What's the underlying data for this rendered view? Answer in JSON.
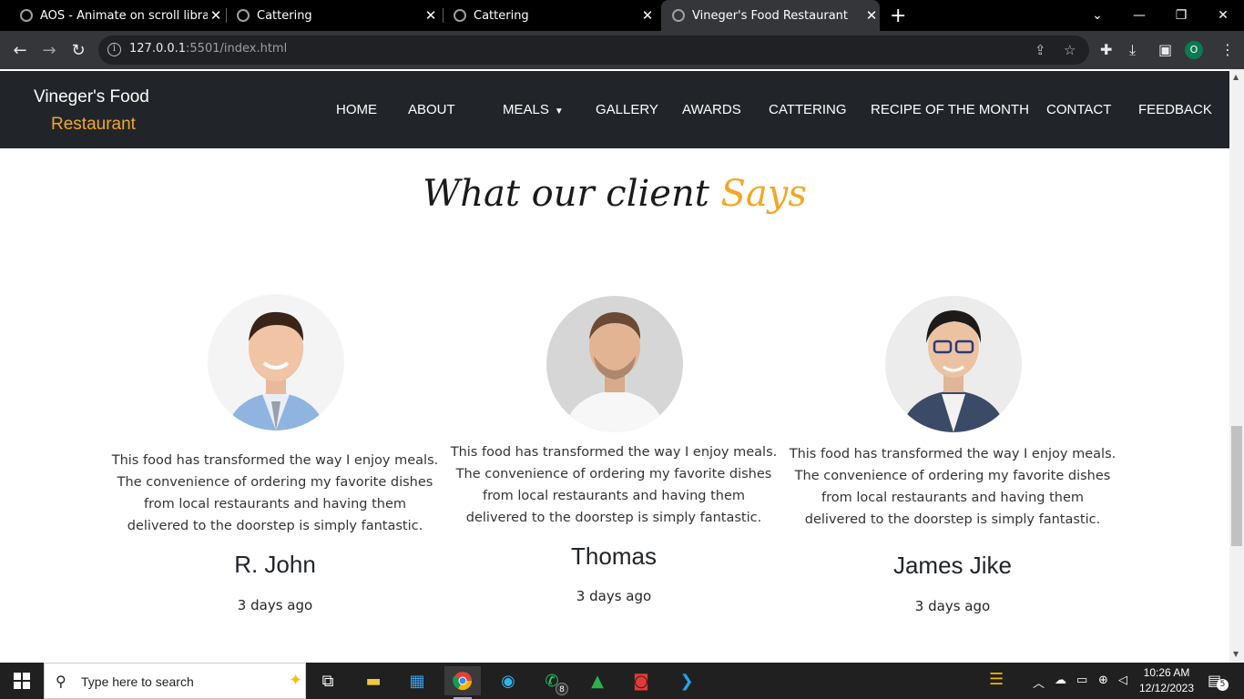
{
  "browser": {
    "tabs": [
      {
        "title": "AOS - Animate on scroll library",
        "active": false
      },
      {
        "title": "Cattering",
        "active": false
      },
      {
        "title": "Cattering",
        "active": false
      },
      {
        "title": "Vineger's Food Restaurant",
        "active": true
      }
    ],
    "url_host": "127.0.0.1",
    "url_rest": ":5501/index.html",
    "profile_initial": "O"
  },
  "site": {
    "brand_line1": "Vineger's Food",
    "brand_line2": "Restaurant",
    "brand_accent_color": "#f5a623",
    "nav_bg_color": "#212529",
    "nav": [
      "HOME",
      "ABOUT",
      "MEALS",
      "GALLERY",
      "AWARDS",
      "CATTERING",
      "RECIPE OF THE MONTH",
      "CONTACT",
      "FEEDBACK"
    ]
  },
  "testimonials": {
    "heading_main": "What our client",
    "heading_accent": "Says",
    "items": [
      {
        "quote": "This food has transformed the way I enjoy meals. The convenience of ordering my favorite dishes from local restaurants and having them delivered to the doorstep is simply fantastic.",
        "name": "R. John",
        "time": "3 days ago"
      },
      {
        "quote": "This food has transformed the way I enjoy meals. The convenience of ordering my favorite dishes from local restaurants and having them delivered to the doorstep is simply fantastic.",
        "name": "Thomas",
        "time": "3 days ago"
      },
      {
        "quote": "This food has transformed the way I enjoy meals. The convenience of ordering my favorite dishes from local restaurants and having them delivered to the doorstep is simply fantastic.",
        "name": "James Jike",
        "time": "3 days ago"
      }
    ]
  },
  "taskbar": {
    "search_placeholder": "Type here to search",
    "whatsapp_badge": "8",
    "time": "10:26 AM",
    "date": "12/12/2023",
    "notification_count": "5"
  }
}
